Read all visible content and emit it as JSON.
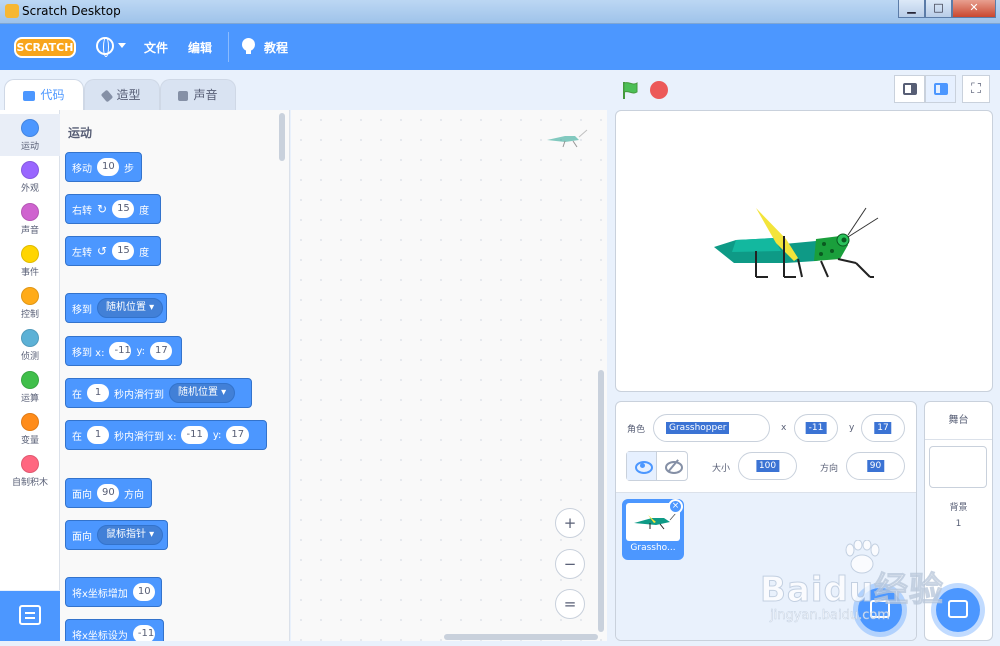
{
  "window": {
    "title": "Scratch Desktop",
    "minimize": "▁",
    "maximize": "□",
    "close": "✕"
  },
  "menubar": {
    "logo": "SCRATCH",
    "file": "文件",
    "edit": "编辑",
    "tutorials": "教程"
  },
  "tabs": {
    "code": "代码",
    "costumes": "造型",
    "sounds": "声音"
  },
  "categories": [
    {
      "label": "运动",
      "color": "#4c97ff"
    },
    {
      "label": "外观",
      "color": "#9966ff"
    },
    {
      "label": "声音",
      "color": "#cf63cf"
    },
    {
      "label": "事件",
      "color": "#ffd500"
    },
    {
      "label": "控制",
      "color": "#ffab19"
    },
    {
      "label": "侦测",
      "color": "#5cb1d6"
    },
    {
      "label": "运算",
      "color": "#40bf4a"
    },
    {
      "label": "变量",
      "color": "#ff8c1a"
    },
    {
      "label": "自制积木",
      "color": "#ff6680"
    }
  ],
  "palette": {
    "title": "运动",
    "move": {
      "w1": "移动",
      "n1": "10",
      "w2": "步"
    },
    "turn_right": {
      "w1": "右转",
      "n1": "15",
      "w2": "度"
    },
    "turn_left": {
      "w1": "左转",
      "n1": "15",
      "w2": "度"
    },
    "goto": {
      "w1": "移到",
      "dd": "随机位置"
    },
    "goto_xy": {
      "w1": "移到 x:",
      "n1": "-11",
      "w2": "y:",
      "n2": "17"
    },
    "glide": {
      "w1": "在",
      "n1": "1",
      "w2": "秒内滑行到",
      "dd": "随机位置"
    },
    "glide_xy": {
      "w1": "在",
      "n1": "1",
      "w2": "秒内滑行到 x:",
      "n2": "-11",
      "w3": "y:",
      "n3": "17"
    },
    "point_dir": {
      "w1": "面向",
      "n1": "90",
      "w2": "方向"
    },
    "point_towards": {
      "w1": "面向",
      "dd": "鼠标指针"
    },
    "change_x": {
      "w1": "将x坐标增加",
      "n1": "10"
    },
    "set_x": {
      "w1": "将x坐标设为",
      "n1": "-11"
    }
  },
  "zoom": {
    "in": "+",
    "out": "−",
    "reset": "="
  },
  "sprite_info": {
    "sprite_label": "角色",
    "sprite_name": "Grasshopper",
    "x_label": "x",
    "x_value": "-11",
    "y_label": "y",
    "y_value": "17",
    "size_label": "大小",
    "size_value": "100",
    "direction_label": "方向",
    "direction_value": "90"
  },
  "sprite_thumb": {
    "name": "Grassho..."
  },
  "stage_panel": {
    "title": "舞台",
    "backdrops_label": "背景",
    "backdrops_count": "1"
  },
  "watermark": {
    "big": "Baidu经验",
    "small": "jingyan.baidu.com"
  },
  "colors": {
    "accent": "#4c97ff",
    "menubar": "#4c97ff",
    "stop": "#ec5959",
    "flag": "#4cbf56"
  }
}
